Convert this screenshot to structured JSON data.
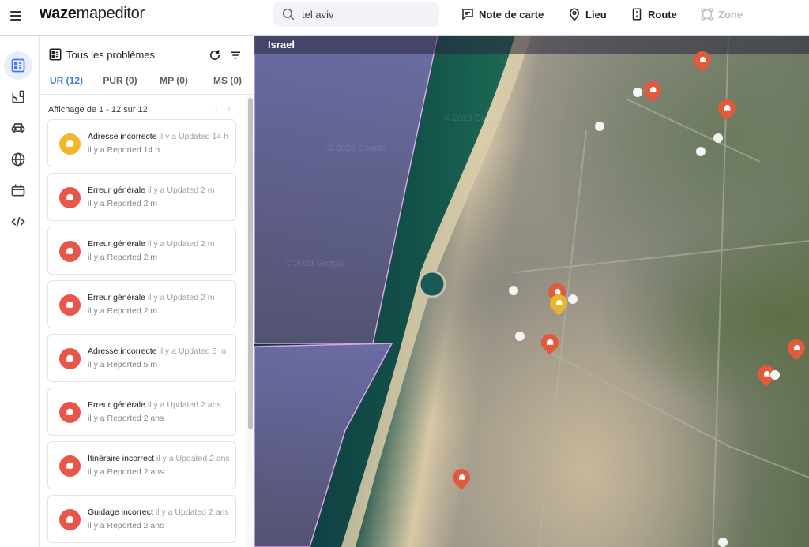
{
  "app": {
    "logo_bold": "waze",
    "logo_light": "mapeditor"
  },
  "search": {
    "value": "tel aviv",
    "placeholder": ""
  },
  "toolbar": {
    "map_note": "Note de carte",
    "place": "Lieu",
    "road": "Route",
    "zone": "Zone"
  },
  "rail": {
    "items": [
      {
        "icon": "issues-list-icon",
        "active": true
      },
      {
        "icon": "map-layers-icon",
        "active": false
      },
      {
        "icon": "car-icon",
        "active": false
      },
      {
        "icon": "globe-icon",
        "active": false
      },
      {
        "icon": "calendar-icon",
        "active": false
      },
      {
        "icon": "code-icon",
        "active": false
      }
    ]
  },
  "panel": {
    "title": "Tous les problèmes",
    "tabs": [
      {
        "label": "UR (12)",
        "active": true
      },
      {
        "label": "PUR (0)",
        "active": false
      },
      {
        "label": "MP (0)",
        "active": false
      },
      {
        "label": "MS (0)",
        "active": false
      }
    ],
    "list_info": "Affichage de 1 - 12 sur 12",
    "prev": "‹",
    "next": "›",
    "items": [
      {
        "title": "Adresse incorrecte",
        "updated": "il y a Updated 14 h",
        "reported": "il y a Reported 14 h",
        "status": "yellow"
      },
      {
        "title": "Erreur générale",
        "updated": "il y a Updated 2 m",
        "reported": "il y a Reported 2 m",
        "status": "red"
      },
      {
        "title": "Erreur générale",
        "updated": "il y a Updated 2 m",
        "reported": "il y a Reported 2 m",
        "status": "red"
      },
      {
        "title": "Erreur générale",
        "updated": "il y a Updated 2 m",
        "reported": "il y a Reported 2 m",
        "status": "red"
      },
      {
        "title": "Adresse incorrecte",
        "updated": "il y a Updated 5 m",
        "reported": "il y a Reported 5 m",
        "status": "red"
      },
      {
        "title": "Erreur générale",
        "updated": "il y a Updated 2 ans",
        "reported": "il y a Reported 2 ans",
        "status": "red"
      },
      {
        "title": "Itinéraire incorrect",
        "updated": "il y a Updated 2 ans",
        "reported": "il y a Reported 2 ans",
        "status": "red"
      },
      {
        "title": "Guidage incorrect",
        "updated": "il y a Updated 2 ans",
        "reported": "il y a Reported 2 ans",
        "status": "red"
      }
    ]
  },
  "map": {
    "region": "Israel",
    "watermark": "© 2023 Google"
  },
  "colors": {
    "accent": "#3d7de6",
    "ur_red": "#e8564a",
    "ur_yellow": "#f0b72f",
    "pin_red": "#e25a3c",
    "pin_yellow": "#eab52c",
    "region_border": "#d9a6e8"
  }
}
